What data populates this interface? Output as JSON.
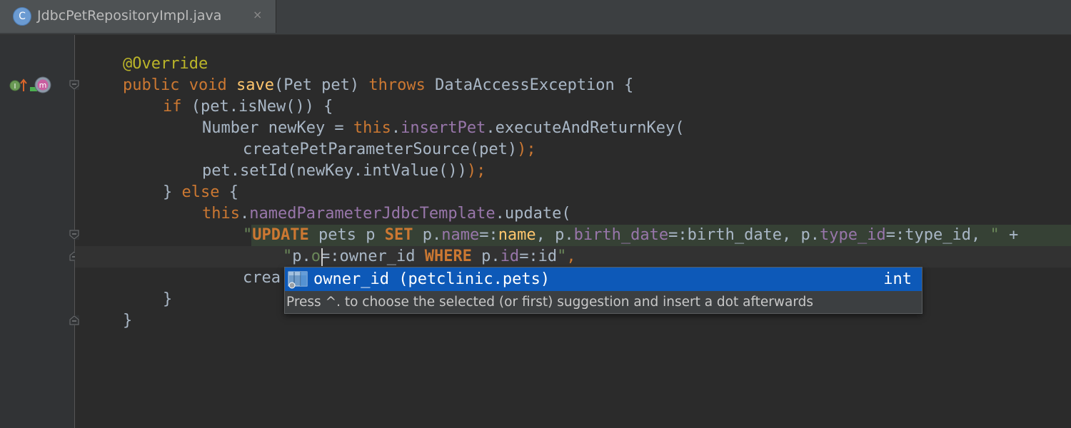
{
  "tab": {
    "icon_letter": "C",
    "title": "JdbcPetRepositoryImpl.java",
    "close_glyph": "×"
  },
  "gutter": {
    "implements_icon": "implements-up-icon",
    "method_icon": "method-m-icon",
    "impl_letter_i": "I",
    "impl_letter_m": "m"
  },
  "colors": {
    "background": "#2b2b2b",
    "keyword": "#cc7832",
    "annotation": "#bbb529",
    "method": "#ffc66d",
    "field": "#9876aa",
    "string": "#6a8759",
    "selection": "#0d59b8"
  },
  "code": {
    "line1": {
      "annotation": "@Override"
    },
    "line2": {
      "kw1": "public",
      "sp1": " ",
      "kw2": "void",
      "sp2": " ",
      "method": "save",
      "params": "(Pet pet) ",
      "kw3": "throws",
      "rest": " DataAccessException {"
    },
    "line3": {
      "kw": "if",
      "rest": " (pet.isNew()) {"
    },
    "line4": {
      "pre": "Number newKey = ",
      "kw": "this",
      "dot": ".",
      "field": "insertPet",
      "rest": ".executeAndReturnKey("
    },
    "line5": {
      "text": "createPetParameterSource(pet)",
      "semi": ");"
    },
    "line6": {
      "text": "pet.setId(newKey.intValue())",
      "semi": ");"
    },
    "line7": {
      "pre": "} ",
      "kw": "else",
      "rest": " {"
    },
    "line8": {
      "kw": "this",
      "dot": ".",
      "field": "namedParameterJdbcTemplate",
      "rest": ".update("
    },
    "line9": {
      "q": "\"",
      "update": "UPDATE",
      "t1": " pets p ",
      "set": "SET",
      "t2": " p.",
      "c1": "name",
      "t3": "=:",
      "name_param": "name",
      "t4": ", p.",
      "c2": "birth_date",
      "t5": "=:birth_date, p.",
      "c3": "type_id",
      "t6": "=:type_id, ",
      "q2": "\"",
      "plus": " +"
    },
    "line10": {
      "q": "\"",
      "t1": "p.",
      "typed": "o",
      "t2": "=:owner_id ",
      "where": "WHERE",
      "t3": " p.",
      "c1": "id",
      "t4": "=:id",
      "q2": "\"",
      "comma": ","
    },
    "line11": {
      "text": "crea"
    },
    "line12": {
      "text": "}"
    },
    "line13": {
      "text": "}"
    }
  },
  "completion": {
    "item_icon": "db-column-icon",
    "item_label": "owner_id (petclinic.pets)",
    "item_type": "int",
    "hint": "Press ^. to choose the selected (or first) suggestion and insert a dot afterwards"
  }
}
